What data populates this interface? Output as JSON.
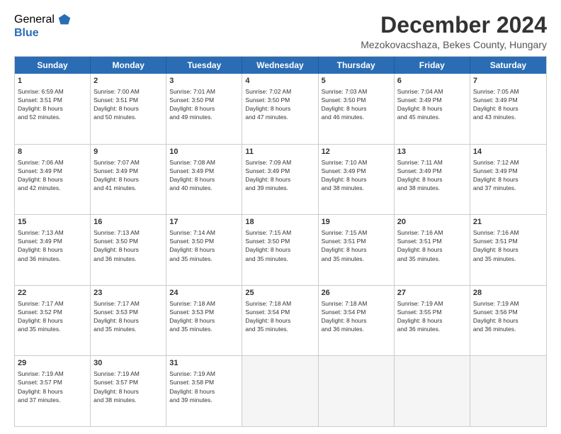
{
  "logo": {
    "general": "General",
    "blue": "Blue"
  },
  "header": {
    "title": "December 2024",
    "location": "Mezokovacshaza, Bekes County, Hungary"
  },
  "days": [
    "Sunday",
    "Monday",
    "Tuesday",
    "Wednesday",
    "Thursday",
    "Friday",
    "Saturday"
  ],
  "weeks": [
    [
      {
        "day": "1",
        "lines": [
          "Sunrise: 6:59 AM",
          "Sunset: 3:51 PM",
          "Daylight: 8 hours",
          "and 52 minutes."
        ]
      },
      {
        "day": "2",
        "lines": [
          "Sunrise: 7:00 AM",
          "Sunset: 3:51 PM",
          "Daylight: 8 hours",
          "and 50 minutes."
        ]
      },
      {
        "day": "3",
        "lines": [
          "Sunrise: 7:01 AM",
          "Sunset: 3:50 PM",
          "Daylight: 8 hours",
          "and 49 minutes."
        ]
      },
      {
        "day": "4",
        "lines": [
          "Sunrise: 7:02 AM",
          "Sunset: 3:50 PM",
          "Daylight: 8 hours",
          "and 47 minutes."
        ]
      },
      {
        "day": "5",
        "lines": [
          "Sunrise: 7:03 AM",
          "Sunset: 3:50 PM",
          "Daylight: 8 hours",
          "and 46 minutes."
        ]
      },
      {
        "day": "6",
        "lines": [
          "Sunrise: 7:04 AM",
          "Sunset: 3:49 PM",
          "Daylight: 8 hours",
          "and 45 minutes."
        ]
      },
      {
        "day": "7",
        "lines": [
          "Sunrise: 7:05 AM",
          "Sunset: 3:49 PM",
          "Daylight: 8 hours",
          "and 43 minutes."
        ]
      }
    ],
    [
      {
        "day": "8",
        "lines": [
          "Sunrise: 7:06 AM",
          "Sunset: 3:49 PM",
          "Daylight: 8 hours",
          "and 42 minutes."
        ]
      },
      {
        "day": "9",
        "lines": [
          "Sunrise: 7:07 AM",
          "Sunset: 3:49 PM",
          "Daylight: 8 hours",
          "and 41 minutes."
        ]
      },
      {
        "day": "10",
        "lines": [
          "Sunrise: 7:08 AM",
          "Sunset: 3:49 PM",
          "Daylight: 8 hours",
          "and 40 minutes."
        ]
      },
      {
        "day": "11",
        "lines": [
          "Sunrise: 7:09 AM",
          "Sunset: 3:49 PM",
          "Daylight: 8 hours",
          "and 39 minutes."
        ]
      },
      {
        "day": "12",
        "lines": [
          "Sunrise: 7:10 AM",
          "Sunset: 3:49 PM",
          "Daylight: 8 hours",
          "and 38 minutes."
        ]
      },
      {
        "day": "13",
        "lines": [
          "Sunrise: 7:11 AM",
          "Sunset: 3:49 PM",
          "Daylight: 8 hours",
          "and 38 minutes."
        ]
      },
      {
        "day": "14",
        "lines": [
          "Sunrise: 7:12 AM",
          "Sunset: 3:49 PM",
          "Daylight: 8 hours",
          "and 37 minutes."
        ]
      }
    ],
    [
      {
        "day": "15",
        "lines": [
          "Sunrise: 7:13 AM",
          "Sunset: 3:49 PM",
          "Daylight: 8 hours",
          "and 36 minutes."
        ]
      },
      {
        "day": "16",
        "lines": [
          "Sunrise: 7:13 AM",
          "Sunset: 3:50 PM",
          "Daylight: 8 hours",
          "and 36 minutes."
        ]
      },
      {
        "day": "17",
        "lines": [
          "Sunrise: 7:14 AM",
          "Sunset: 3:50 PM",
          "Daylight: 8 hours",
          "and 35 minutes."
        ]
      },
      {
        "day": "18",
        "lines": [
          "Sunrise: 7:15 AM",
          "Sunset: 3:50 PM",
          "Daylight: 8 hours",
          "and 35 minutes."
        ]
      },
      {
        "day": "19",
        "lines": [
          "Sunrise: 7:15 AM",
          "Sunset: 3:51 PM",
          "Daylight: 8 hours",
          "and 35 minutes."
        ]
      },
      {
        "day": "20",
        "lines": [
          "Sunrise: 7:16 AM",
          "Sunset: 3:51 PM",
          "Daylight: 8 hours",
          "and 35 minutes."
        ]
      },
      {
        "day": "21",
        "lines": [
          "Sunrise: 7:16 AM",
          "Sunset: 3:51 PM",
          "Daylight: 8 hours",
          "and 35 minutes."
        ]
      }
    ],
    [
      {
        "day": "22",
        "lines": [
          "Sunrise: 7:17 AM",
          "Sunset: 3:52 PM",
          "Daylight: 8 hours",
          "and 35 minutes."
        ]
      },
      {
        "day": "23",
        "lines": [
          "Sunrise: 7:17 AM",
          "Sunset: 3:53 PM",
          "Daylight: 8 hours",
          "and 35 minutes."
        ]
      },
      {
        "day": "24",
        "lines": [
          "Sunrise: 7:18 AM",
          "Sunset: 3:53 PM",
          "Daylight: 8 hours",
          "and 35 minutes."
        ]
      },
      {
        "day": "25",
        "lines": [
          "Sunrise: 7:18 AM",
          "Sunset: 3:54 PM",
          "Daylight: 8 hours",
          "and 35 minutes."
        ]
      },
      {
        "day": "26",
        "lines": [
          "Sunrise: 7:18 AM",
          "Sunset: 3:54 PM",
          "Daylight: 8 hours",
          "and 36 minutes."
        ]
      },
      {
        "day": "27",
        "lines": [
          "Sunrise: 7:19 AM",
          "Sunset: 3:55 PM",
          "Daylight: 8 hours",
          "and 36 minutes."
        ]
      },
      {
        "day": "28",
        "lines": [
          "Sunrise: 7:19 AM",
          "Sunset: 3:56 PM",
          "Daylight: 8 hours",
          "and 36 minutes."
        ]
      }
    ],
    [
      {
        "day": "29",
        "lines": [
          "Sunrise: 7:19 AM",
          "Sunset: 3:57 PM",
          "Daylight: 8 hours",
          "and 37 minutes."
        ]
      },
      {
        "day": "30",
        "lines": [
          "Sunrise: 7:19 AM",
          "Sunset: 3:57 PM",
          "Daylight: 8 hours",
          "and 38 minutes."
        ]
      },
      {
        "day": "31",
        "lines": [
          "Sunrise: 7:19 AM",
          "Sunset: 3:58 PM",
          "Daylight: 8 hours",
          "and 39 minutes."
        ]
      },
      null,
      null,
      null,
      null
    ]
  ]
}
